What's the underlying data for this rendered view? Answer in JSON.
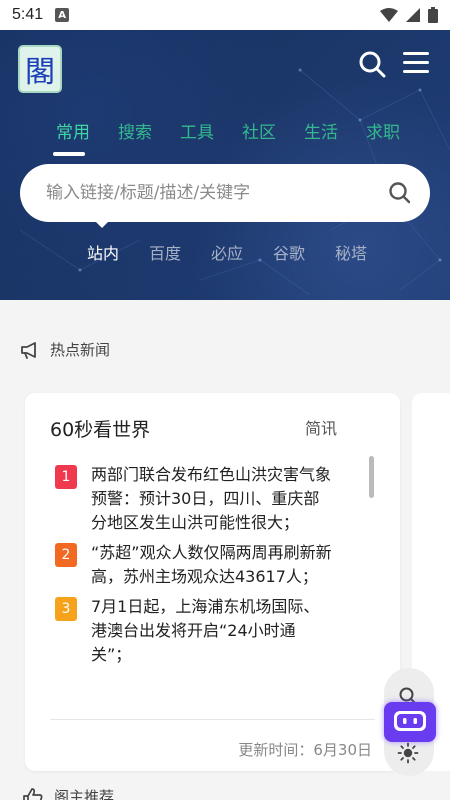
{
  "status_bar": {
    "time": "5:41",
    "notification_letter": "A"
  },
  "app": {
    "logo_char": "閣"
  },
  "category_tabs": [
    {
      "label": "常用",
      "active": true
    },
    {
      "label": "搜索",
      "active": false
    },
    {
      "label": "工具",
      "active": false
    },
    {
      "label": "社区",
      "active": false
    },
    {
      "label": "生活",
      "active": false
    },
    {
      "label": "求职",
      "active": false
    }
  ],
  "search": {
    "placeholder": "输入链接/标题/描述/关键字"
  },
  "engine_tabs": [
    {
      "label": "站内",
      "active": true
    },
    {
      "label": "百度",
      "active": false
    },
    {
      "label": "必应",
      "active": false
    },
    {
      "label": "谷歌",
      "active": false
    },
    {
      "label": "秘塔",
      "active": false
    }
  ],
  "hot_news": {
    "section_title": "热点新闻"
  },
  "news_card": {
    "title": "60秒看世界",
    "tag": "简讯",
    "items": [
      {
        "num": "1",
        "color": "#f0394e",
        "text": "两部门联合发布红色山洪灾害气象预警：预计30日，四川、重庆部分地区发生山洪可能性很大；"
      },
      {
        "num": "2",
        "color": "#f26a21",
        "text": "“苏超”观众人数仅隔两周再刷新新高，苏州主场观众达43617人；"
      },
      {
        "num": "3",
        "color": "#f7a21b",
        "text": "7月1日起，上海浦东机场国际、港澳台出发将开启“24小时通关”；"
      }
    ],
    "footer": "更新时间：6月30日"
  },
  "recommend": {
    "section_title": "阁主推荐"
  },
  "colors": {
    "accent": "#40d6a4",
    "hero_bg": "#1b3668",
    "bot": "#6a3cf0"
  }
}
